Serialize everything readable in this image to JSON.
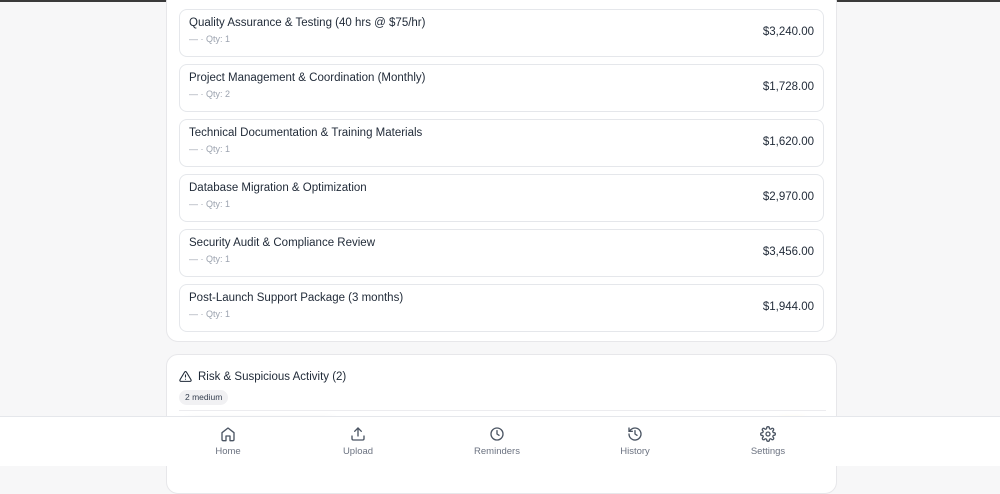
{
  "line_items": [
    {
      "description": "Quality Assurance & Testing (40 hrs @ $75/hr)",
      "meta": "— · Qty: 1",
      "amount": "$3,240.00"
    },
    {
      "description": "Project Management & Coordination (Monthly)",
      "meta": "— · Qty: 2",
      "amount": "$1,728.00"
    },
    {
      "description": "Technical Documentation & Training Materials",
      "meta": "— · Qty: 1",
      "amount": "$1,620.00"
    },
    {
      "description": "Database Migration & Optimization",
      "meta": "— · Qty: 1",
      "amount": "$2,970.00"
    },
    {
      "description": "Security Audit & Compliance Review",
      "meta": "— · Qty: 1",
      "amount": "$3,456.00"
    },
    {
      "description": "Post-Launch Support Package (3 months)",
      "meta": "— · Qty: 1",
      "amount": "$1,944.00"
    }
  ],
  "risk": {
    "icon": "warning-triangle-icon",
    "title": "Risk & Suspicious Activity (2)",
    "badge": "2 medium"
  },
  "nav": {
    "items": [
      {
        "label": "Home",
        "icon": "home-icon"
      },
      {
        "label": "Upload",
        "icon": "upload-icon"
      },
      {
        "label": "Reminders",
        "icon": "clock-icon"
      },
      {
        "label": "History",
        "icon": "history-icon"
      },
      {
        "label": "Settings",
        "icon": "gear-icon"
      }
    ]
  },
  "colors": {
    "background": "#f7f7f8",
    "card": "#ffffff",
    "border": "#e5e7eb",
    "text": "#1f2937",
    "muted": "#9ca3af"
  }
}
